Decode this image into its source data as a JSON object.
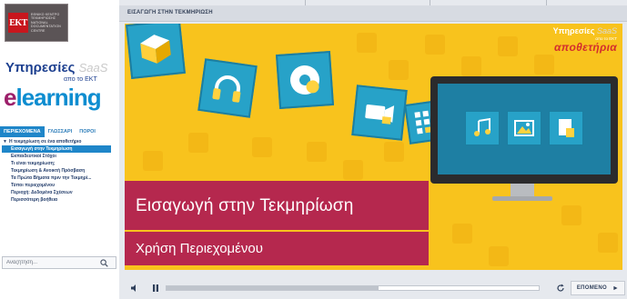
{
  "sidebar": {
    "logo": {
      "mark": "EKT",
      "lines": [
        "ΕΘΝΙΚΟ ΚΕΝΤΡΟ",
        "ΤΕΚΜΗΡΙΩΣΗΣ",
        "NATIONAL",
        "DOCUMENTATION",
        "CENTRE"
      ]
    },
    "brand_services": "Υπηρεσίες",
    "brand_saas": "SaaS",
    "brand_from": "απο το ΕΚΤ",
    "brand_e": "e",
    "brand_rest": "learning",
    "tabs": [
      {
        "label": "ΠΕΡΙΕΧΟΜΕΝΑ",
        "active": true
      },
      {
        "label": "ΓΛΩΣΣΑΡΙ",
        "active": false
      },
      {
        "label": "ΠΟΡΟΙ",
        "active": false
      }
    ],
    "toc": {
      "root_label": "Η τεκμηρίωση σε ένα αποθετήριο",
      "items": [
        {
          "label": "Εισαγωγή στην Τεκμηρίωση",
          "active": true
        },
        {
          "label": "Εκπαιδευτικοί Στόχοι",
          "active": false
        },
        {
          "label": "Τι είναι τεκμηρίωση;",
          "active": false
        },
        {
          "label": "Τεκμηρίωση & Ανοικτή Πρόσβαση",
          "active": false
        },
        {
          "label": "Τα Πρώτα Βήματα πριν την Τεκμηρί...",
          "active": false
        },
        {
          "label": "Τύποι περιεχομένου",
          "active": false
        },
        {
          "label": "Περιοχή: Δεδομένα Σχέσεων",
          "active": false
        },
        {
          "label": "Περισσότερη βοήθεια",
          "active": false
        }
      ]
    },
    "search": {
      "placeholder": "Αναζήτηση..."
    }
  },
  "main": {
    "section_title": "ΕΙΣΑΓΩΓΗ ΣΤΗΝ ΤΕΚΜΗΡΙΩΣΗ",
    "slide": {
      "title": "Εισαγωγή στην Τεκμηρίωση",
      "subtitle": "Χρήση Περιεχομένου",
      "brand_services": "Υπηρεσίες",
      "brand_saas": "SaaS",
      "brand_from": "απο το ΕΚΤ",
      "brand_repo": "αποθετήρια"
    },
    "player": {
      "progress": 0.57,
      "next_label": "ΕΠΟΜΕΝΟ"
    }
  },
  "colors": {
    "accent_blue": "#1f86c9",
    "slide_yellow": "#f8c31d",
    "slide_band": "#b5284e",
    "tile_blue": "#27a2c8"
  }
}
